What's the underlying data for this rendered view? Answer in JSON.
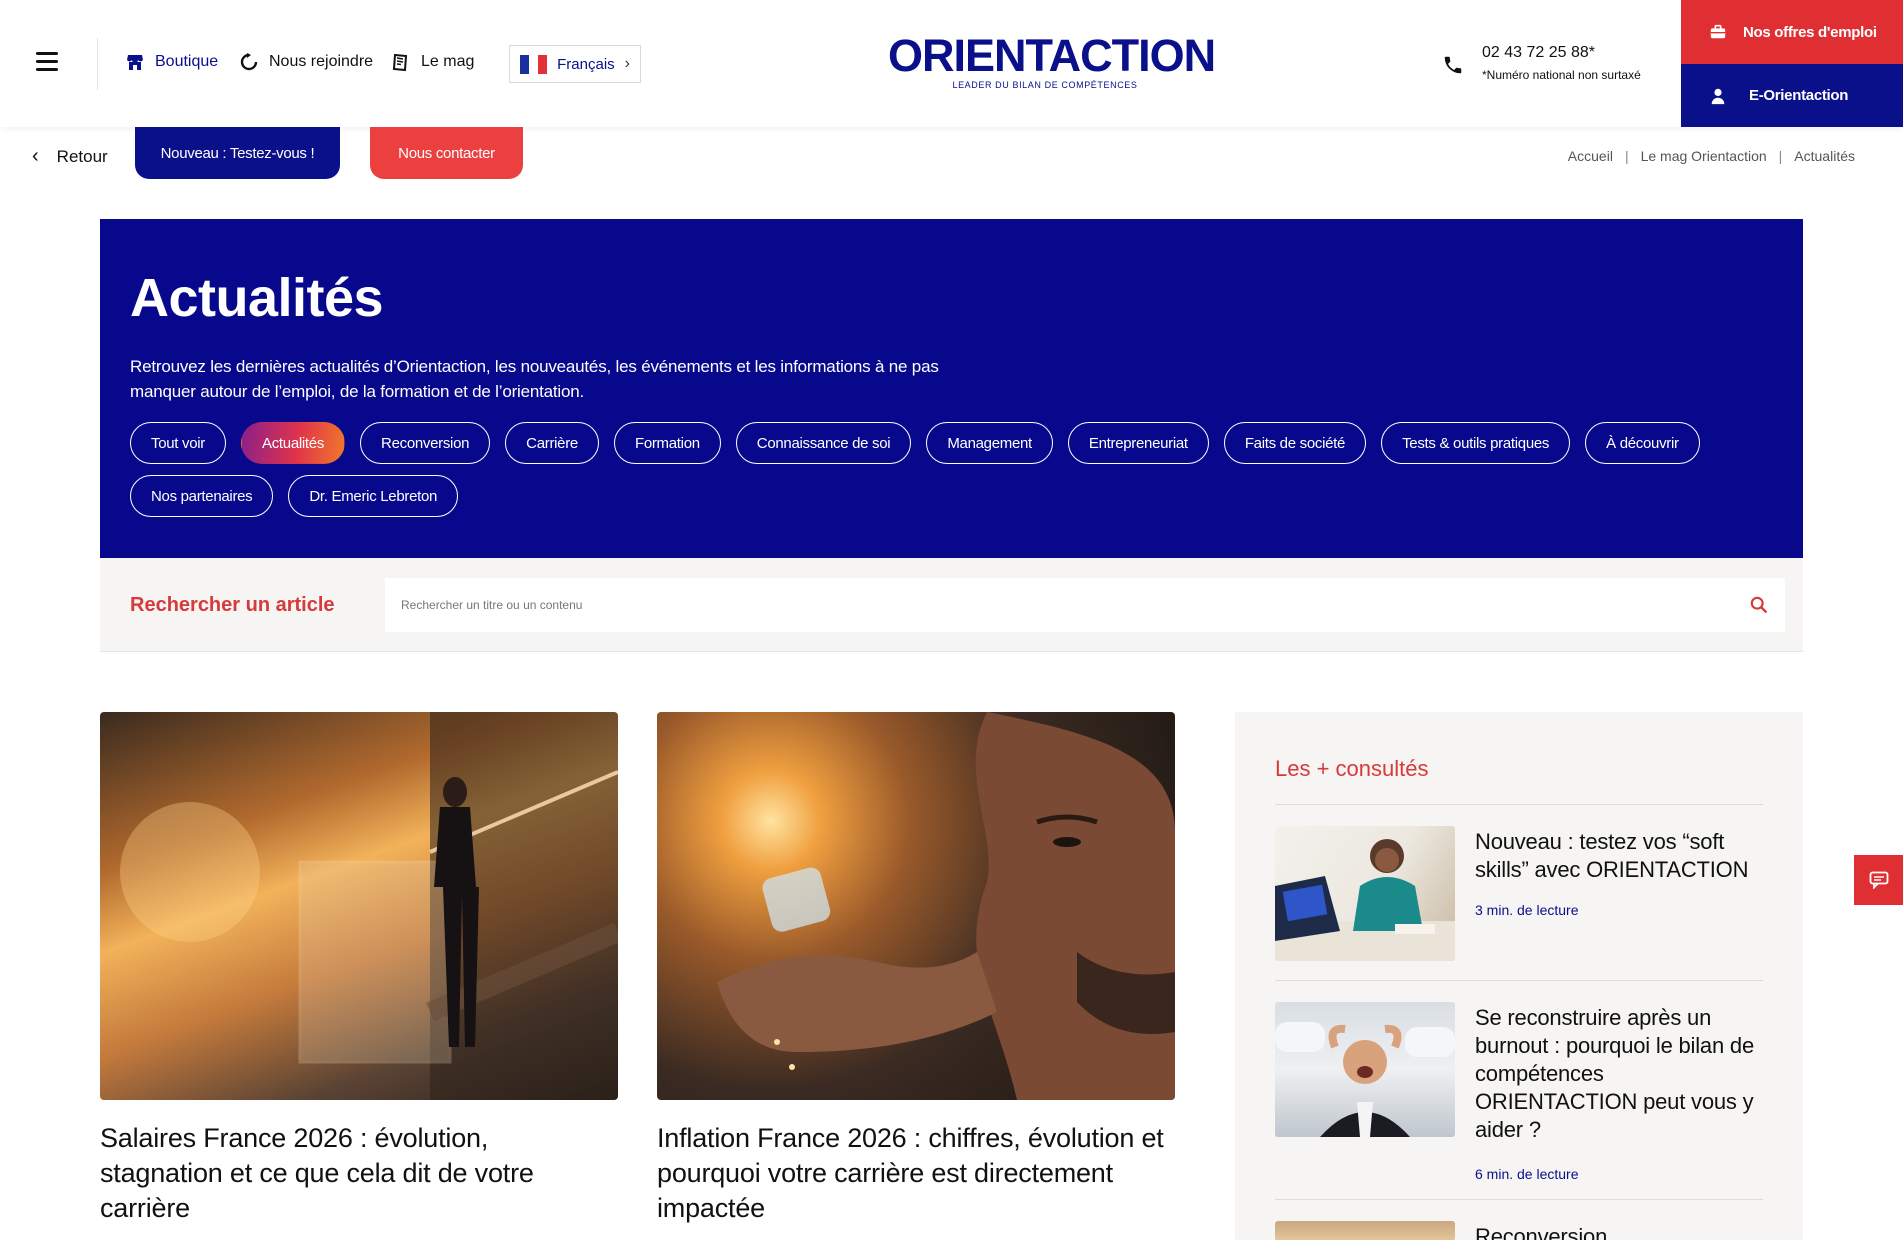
{
  "header": {
    "nav": [
      {
        "label": "Boutique",
        "icon": "shop-icon"
      },
      {
        "label": "Nous rejoindre",
        "icon": "refresh-icon"
      },
      {
        "label": "Le mag",
        "icon": "magazine-icon"
      }
    ],
    "language": "Français",
    "logo": {
      "text": "ORIENTACTION",
      "subtitle": "LEADER DU BILAN DE COMPÉTENCES"
    },
    "phone": {
      "number": "02 43 72 25 88*",
      "note": "*Numéro national non surtaxé"
    },
    "jobs_button": "Nos offres d'emploi",
    "eorientaction_button": "E-Orientaction"
  },
  "subbar": {
    "back": "Retour",
    "test_button": "Nouveau : Testez-vous !",
    "contact_button": "Nous contacter",
    "breadcrumb": [
      "Accueil",
      "Le mag Orientaction",
      "Actualités"
    ]
  },
  "hero": {
    "title": "Actualités",
    "description": "Retrouvez les dernières actualités d’Orientaction, les nouveautés, les événements et les informations à ne pas manquer autour de l’emploi, de la formation et de l’orientation.",
    "chips": [
      "Tout voir",
      "Actualités",
      "Reconversion",
      "Carrière",
      "Formation",
      "Connaissance de soi",
      "Management",
      "Entrepreneuriat",
      "Faits de société",
      "Tests & outils pratiques",
      "À découvrir",
      "Nos partenaires",
      "Dr. Emeric Lebreton"
    ],
    "active_chip": "Actualités"
  },
  "search": {
    "label": "Rechercher un article",
    "placeholder": "Rechercher un titre ou un contenu"
  },
  "articles": [
    {
      "title": "Salaires France 2026 : évolution, stagnation et ce que cela dit de votre carrière"
    },
    {
      "title": "Inflation France 2026 : chiffres, évolution et pourquoi votre carrière est directement impactée"
    }
  ],
  "sidebar": {
    "title": "Les + consultés",
    "items": [
      {
        "title": "Nouveau : testez vos “soft skills” avec ORIENTACTION",
        "meta": "3 min. de lecture"
      },
      {
        "title": "Se reconstruire après un burnout : pourquoi le bilan de compétences ORIENTACTION peut vous y aider ?",
        "meta": "6 min. de lecture"
      },
      {
        "title": "Reconversion",
        "meta": ""
      }
    ]
  },
  "colors": {
    "brand_blue": "#0a0f8a",
    "hero_blue": "#07088c",
    "brand_red": "#e02f32",
    "accent_red": "#d63a3a"
  }
}
